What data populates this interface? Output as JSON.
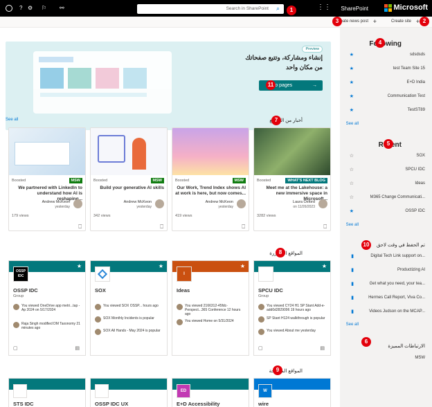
{
  "topbar": {
    "brand": "Microsoft",
    "app": "SharePoint",
    "search_placeholder": "Search in SharePoint",
    "help": "?"
  },
  "cmdbar": {
    "create_site": "Create site",
    "create_news": "Create news post"
  },
  "hero": {
    "preview": "Preview",
    "title_line1": "إنشاء ومشاركة، وتتبع صفحاتك",
    "title_line2": "من مكان واحد",
    "cta": "Go to pages"
  },
  "sidebar": {
    "following_title": "Following",
    "following_items": [
      "sdsdsds",
      "test Team Site 15",
      "E+D India",
      "Communication Test",
      "TestST89"
    ],
    "see_all": "See all",
    "recent_title": "Recent",
    "recent_items": [
      "SOX",
      "SPCU IDC",
      "Ideas",
      "M365 Change Communicati...",
      "OSSP IDC"
    ],
    "saved_title": "تم الحفظ في وقت لاحق",
    "saved_items": [
      "Digital Tech Link support on...",
      "Productizing AI",
      "Get what you need, your tea...",
      "Hermes Call Report, Viva Co...",
      "Videos Judson on the MCAP..."
    ],
    "featured_title": "الارتباطات المميزة",
    "featured_items": [
      "MSW"
    ]
  },
  "news": {
    "heading": "أخبار من المواقع",
    "see_all": "See all",
    "cards": [
      {
        "tag": "WHAT'S NEXT BLOG",
        "boost": "Boosted",
        "title": "Meet me at the Lakehouse: a new immersive space in Microsoft...",
        "author": "Laura Oxford",
        "date": "on 11/26/2023",
        "views": "3282 views"
      },
      {
        "tag": "MSW",
        "boost": "Boosted",
        "title": "Our Work, Trend Index shows AI at work is here, but now comes...",
        "author": "Andrew McKeon",
        "date": "yesterday",
        "views": "419 views"
      },
      {
        "tag": "MSW",
        "boost": "Boosted",
        "title": "Build your generative AI skills",
        "author": "Andrew McKeon",
        "date": "yesterday",
        "views": "342 views"
      },
      {
        "tag": "MSW",
        "boost": "Boosted",
        "title": "We partnered with LinkedIn to understand how AI is reshaping...",
        "author": "Andrew McKeon",
        "date": "yesterday",
        "views": "179 views"
      }
    ]
  },
  "frequent": {
    "heading": "المواقع المتكررة",
    "sites": [
      {
        "name": "SPCU IDC",
        "group": "Group",
        "logo": "",
        "acts": [
          "You viewed CY24 H1 SP Stant Add-e-add0d2829096 19 hours ago",
          "SP Stant H124 walkthrough is popular",
          "You viewed About me yesterday"
        ]
      },
      {
        "name": "Ideas",
        "group": "",
        "logo": "I",
        "acts": [
          "You viewed 2166312-45fdc-Perspect...365 Conference 12 hours ago",
          "You viewed Home on 5/31/2024"
        ]
      },
      {
        "name": "SOX",
        "group": "",
        "logo": "",
        "acts": [
          "You viewed SOX OSSP... hours ago",
          "SOX Monthly Incidents is popular",
          "SOX All Hands - May 2024 is popular"
        ]
      },
      {
        "name": "OSSP IDC",
        "group": "Group",
        "logo": "OSSP IDC",
        "acts": [
          "You viewed OneDrive app metri...tap - Ap 2024 on 5/17/2024",
          "Raja Singh modified DM Taxonomy 21 minutes ago"
        ]
      }
    ]
  },
  "suggested": {
    "heading": "المواقع المقترحة",
    "sites": [
      {
        "name": "wire",
        "logo": "W"
      },
      {
        "name": "E+D Accessibility",
        "logo": "ED"
      },
      {
        "name": "OSSP IDC UX",
        "logo": ""
      },
      {
        "name": "STS IDC",
        "logo": ""
      }
    ]
  },
  "badges": [
    "1",
    "2",
    "3",
    "4",
    "5",
    "6",
    "7",
    "8",
    "9",
    "10",
    "11"
  ],
  "colors": {
    "teal": "#03787c",
    "orange": "#ca5010",
    "badge": "#e3000b",
    "accent": "#0078d4"
  }
}
